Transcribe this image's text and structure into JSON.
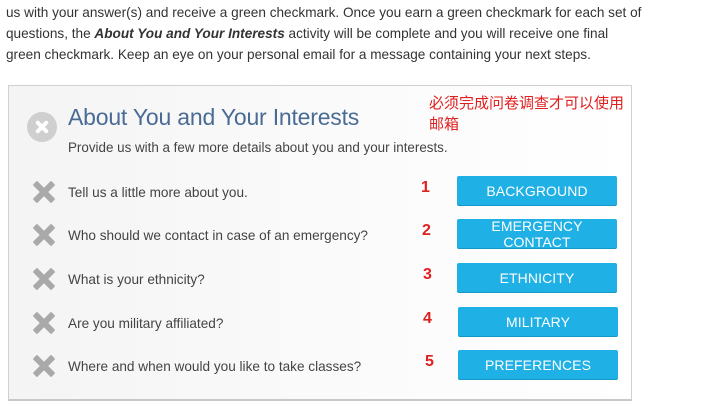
{
  "intro": {
    "text_before": "us with your answer(s) and receive a green checkmark. Once you earn a green checkmark for each set of questions, the ",
    "emphasis": "About You and Your Interests",
    "text_after": " activity will be complete and you will receive one final green checkmark. Keep an eye on your personal email for a message containing your next steps."
  },
  "panel": {
    "title": "About You and Your Interests",
    "subtitle": "Provide us with a few more details about you and your interests.",
    "notice": "必须完成问卷调查才可以使用邮箱",
    "status_icon": "x-circle-icon",
    "rows": [
      {
        "question": "Tell us a little more about you.",
        "number": "1",
        "button": "BACKGROUND",
        "icon": "x-icon"
      },
      {
        "question": "Who should we contact in case of an emergency?",
        "number": "2",
        "button": "EMERGENCY CONTACT",
        "icon": "x-icon"
      },
      {
        "question": "What is your ethnicity?",
        "number": "3",
        "button": "ETHNICITY",
        "icon": "x-icon"
      },
      {
        "question": "Are you military affiliated?",
        "number": "4",
        "button": "MILITARY",
        "icon": "x-icon"
      },
      {
        "question": "Where and when would you like to take classes?",
        "number": "5",
        "button": "PREFERENCES",
        "icon": "x-icon"
      }
    ]
  },
  "colors": {
    "title": "#4a6b94",
    "button": "#1fb0e6",
    "annotation": "#e0201f",
    "incomplete_icon": "#a9a9a9"
  }
}
